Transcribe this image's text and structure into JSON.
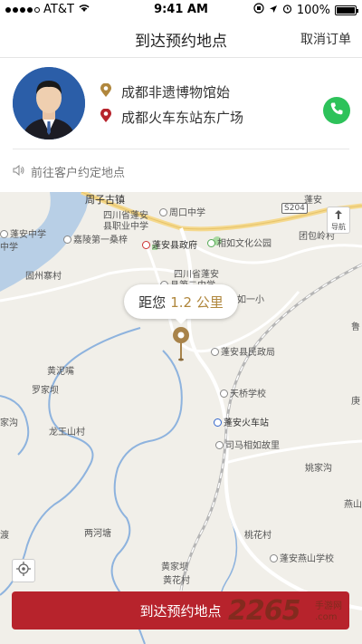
{
  "status_bar": {
    "carrier": "AT&T",
    "time": "9:41 AM",
    "battery": "100%",
    "battery_fraction": 1.0
  },
  "nav": {
    "title": "到达预约地点",
    "cancel_label": "取消订单"
  },
  "driver_card": {
    "pickup_address": "成都非遗博物馆始",
    "destination_address": "成都火车东站东广场",
    "pickup_icon": "location-pin-icon",
    "destination_icon": "location-pin-icon",
    "phone_icon": "phone-icon",
    "colors": {
      "pickup_pin": "#b0873d",
      "destination_pin": "#b7232c",
      "phone": "#2dc25a"
    }
  },
  "tip": {
    "text": "前往客户约定地点",
    "icon": "speaker-icon"
  },
  "map": {
    "navigation_label": "导航",
    "road_tag": "S204",
    "distance_prefix": "距您",
    "distance_value": "1.2 公里",
    "labels": [
      "周子古镇",
      "周口中学",
      "蓬安中学",
      "四川省蓬安",
      "县职业中学",
      "嘉陵第一桑梓",
      "蓬安县政府",
      "相如文化公园",
      "团包岭村",
      "固州寨村",
      "四川省蓬安",
      "县第二中学",
      "如一小",
      "蓬安县民政局",
      "黄泥嘴",
      "罗家坝",
      "天桥学校",
      "蓬安火车站",
      "龙王山村",
      "司马相如故里",
      "姚家沟",
      "燕山",
      "两河塘",
      "桃花村",
      "黄家坝",
      "黄花村",
      "蓬安燕山学校",
      "家沟",
      "渡",
      "鲁",
      "庚",
      "中学",
      "蓬安"
    ]
  },
  "action": {
    "primary_label": "到达预约地点",
    "color": "#b7232c"
  },
  "watermark": {
    "logo_text": "2265",
    "sub_text": "手游网",
    "domain": ".com"
  }
}
